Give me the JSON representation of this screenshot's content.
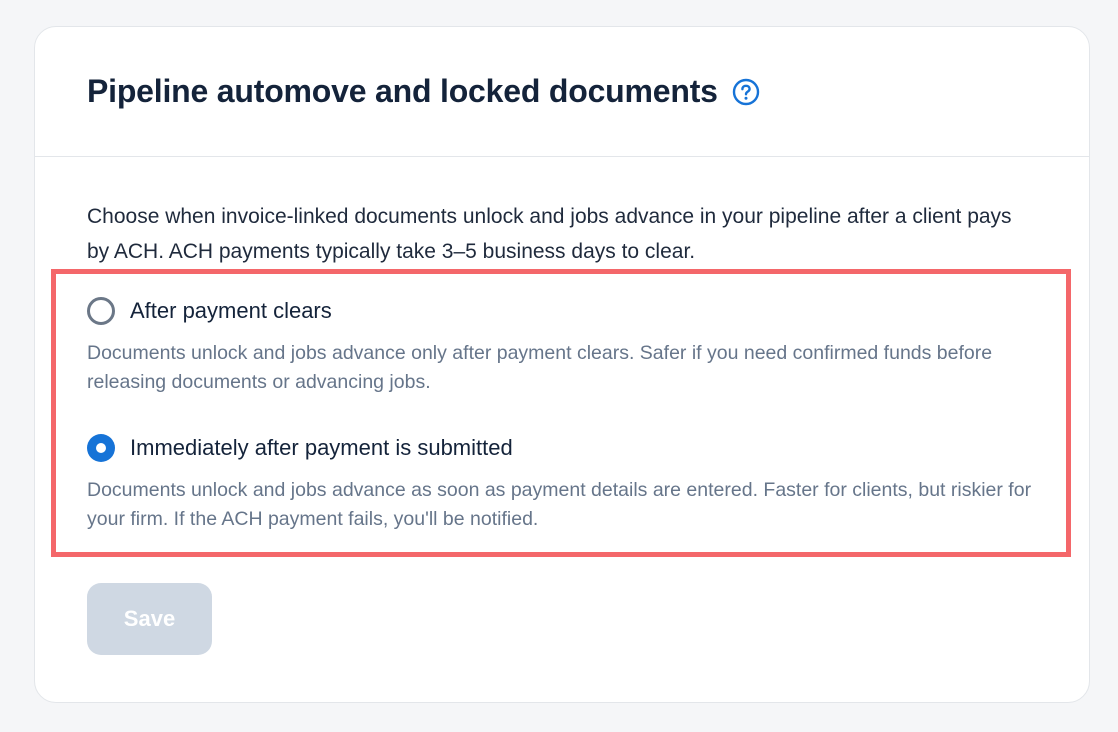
{
  "card": {
    "title": "Pipeline automove and locked documents",
    "help_icon": "question-circle-icon",
    "intro": "Choose when invoice-linked documents unlock and jobs advance in your pipeline after a client pays by ACH. ACH payments typically take 3–5 business days to clear."
  },
  "options": [
    {
      "label": "After payment clears",
      "description": "Documents unlock and jobs advance only after payment clears. Safer if you need confirmed funds before releasing documents or advancing jobs.",
      "selected": false
    },
    {
      "label": "Immediately after payment is submitted",
      "description": "Documents unlock and jobs advance as soon as payment details are entered. Faster for clients, but riskier for your firm. If the ACH payment fails, you'll be notified.",
      "selected": true
    }
  ],
  "save_button": {
    "label": "Save",
    "enabled": false
  },
  "colors": {
    "accent": "#1673d7",
    "highlight_border": "#f4676a",
    "disabled_button": "#cfd8e3"
  }
}
